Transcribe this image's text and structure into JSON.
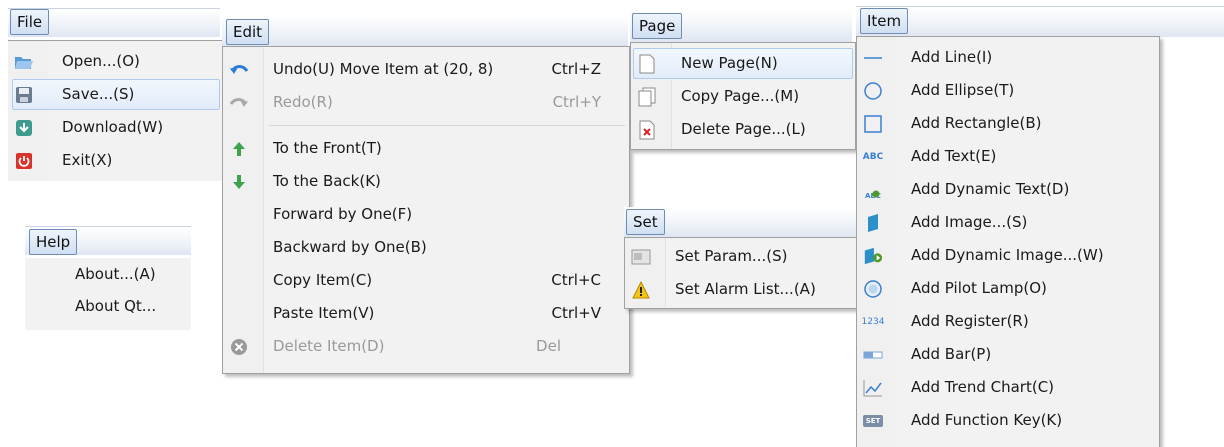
{
  "file_menu": {
    "title": "File",
    "items": [
      {
        "label": "Open...(O)",
        "icon": "open-folder-icon"
      },
      {
        "label": "Save...(S)",
        "icon": "floppy-save-icon"
      },
      {
        "label": "Download(W)",
        "icon": "download-icon"
      },
      {
        "label": "Exit(X)",
        "icon": "exit-power-icon"
      }
    ]
  },
  "help_menu": {
    "title": "Help",
    "items": [
      {
        "label": "About...(A)"
      },
      {
        "label": "About Qt..."
      }
    ]
  },
  "edit_menu": {
    "title": "Edit",
    "items": [
      {
        "label": "Undo(U) Move Item at (20, 8)",
        "shortcut": "Ctrl+Z",
        "icon": "undo-icon",
        "enabled": true
      },
      {
        "label": "Redo(R)",
        "shortcut": "Ctrl+Y",
        "icon": "redo-icon",
        "enabled": false
      },
      {
        "label": "To the Front(T)",
        "icon": "front-arrow-icon",
        "enabled": true
      },
      {
        "label": "To the Back(K)",
        "icon": "back-arrow-icon",
        "enabled": true
      },
      {
        "label": "Forward by One(F)",
        "enabled": true
      },
      {
        "label": "Backward by One(B)",
        "enabled": true
      },
      {
        "label": "Copy Item(C)",
        "shortcut": "Ctrl+C",
        "enabled": true
      },
      {
        "label": "Paste Item(V)",
        "shortcut": "Ctrl+V",
        "enabled": true
      },
      {
        "label": "Delete Item(D)",
        "shortcut": "Del",
        "icon": "delete-icon",
        "enabled": false
      }
    ]
  },
  "page_menu": {
    "title": "Page",
    "items": [
      {
        "label": "New Page(N)",
        "icon": "new-page-icon"
      },
      {
        "label": "Copy Page...(M)",
        "icon": "copy-page-icon"
      },
      {
        "label": "Delete Page...(L)",
        "icon": "delete-page-icon"
      }
    ]
  },
  "set_menu": {
    "title": "Set",
    "items": [
      {
        "label": "Set Param...(S)",
        "icon": "param-icon"
      },
      {
        "label": "Set Alarm List...(A)",
        "icon": "warning-icon"
      }
    ]
  },
  "item_menu": {
    "title": "Item",
    "items": [
      {
        "label": "Add Line(I)",
        "icon": "line-icon"
      },
      {
        "label": "Add Ellipse(T)",
        "icon": "ellipse-icon"
      },
      {
        "label": "Add Rectangle(B)",
        "icon": "rectangle-icon"
      },
      {
        "label": "Add Text(E)",
        "icon": "text-icon",
        "glyph": "ABC"
      },
      {
        "label": "Add Dynamic Text(D)",
        "icon": "dynamic-text-icon",
        "glyph": "ABC"
      },
      {
        "label": "Add Image...(S)",
        "icon": "image-icon"
      },
      {
        "label": "Add Dynamic Image...(W)",
        "icon": "dynamic-image-icon"
      },
      {
        "label": "Add Pilot Lamp(O)",
        "icon": "pilot-lamp-icon"
      },
      {
        "label": "Add Register(R)",
        "icon": "register-icon",
        "glyph": "1234"
      },
      {
        "label": "Add Bar(P)",
        "icon": "bar-icon"
      },
      {
        "label": "Add Trend Chart(C)",
        "icon": "trend-chart-icon"
      },
      {
        "label": "Add Function Key(K)",
        "icon": "function-key-icon",
        "glyph": "SET"
      }
    ]
  }
}
